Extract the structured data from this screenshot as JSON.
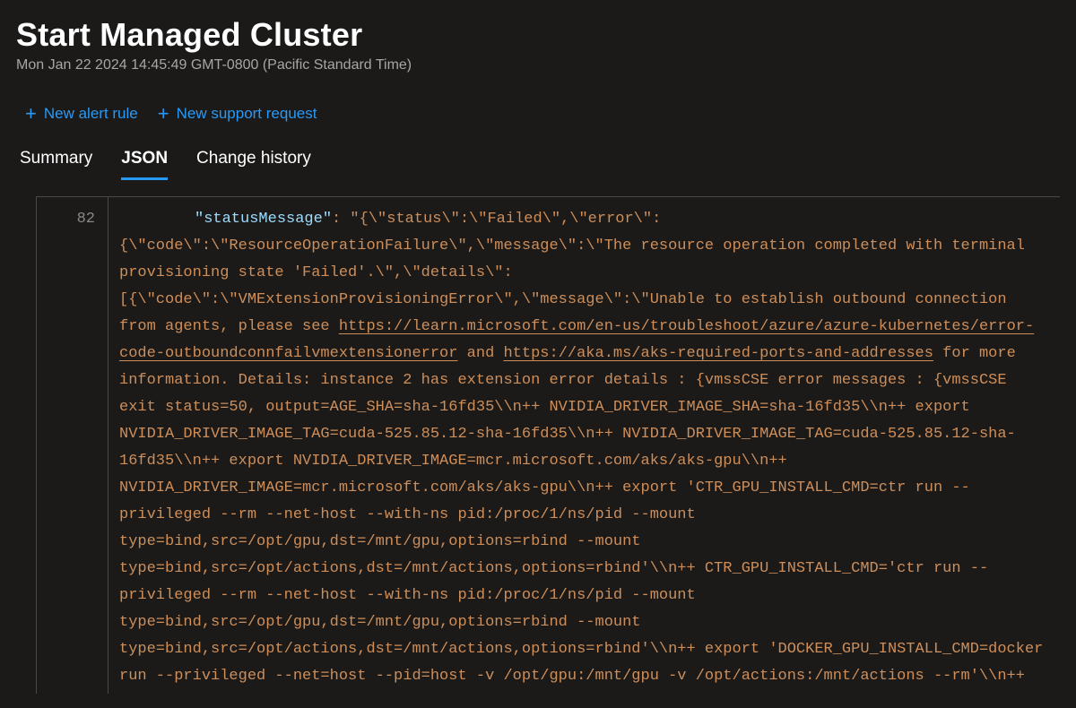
{
  "header": {
    "title": "Start Managed Cluster",
    "subtitle": "Mon Jan 22 2024 14:45:49 GMT-0800 (Pacific Standard Time)"
  },
  "actions": {
    "new_alert": "New alert rule",
    "new_support": "New support request"
  },
  "tabs": {
    "summary": "Summary",
    "json": "JSON",
    "change_history": "Change history"
  },
  "code": {
    "line_number": "82",
    "json_key": "\"statusMessage\"",
    "pre_link_a": ": \"{\\\"status\\\":\\\"Failed\\\",\\\"error\\\":{\\\"code\\\":\\\"ResourceOperationFailure\\\",\\\"message\\\":\\\"The resource operation completed with terminal provisioning state 'Failed'.\\\",\\\"details\\\":[{\\\"code\\\":\\\"VMExtensionProvisioningError\\\",\\\"message\\\":\\\"Unable to establish outbound connection from agents, please see ",
    "link_a": "https://learn.microsoft.com/en-us/troubleshoot/azure/azure-kubernetes/error-code-outboundconnfailvmextensionerror",
    "between_links": " and ",
    "link_b": "https://aka.ms/aks-required-ports-and-addresses",
    "post_link_b": " for more information. Details: instance 2 has extension error details : {vmssCSE error messages : {vmssCSE exit status=50, output=AGE_SHA=sha-16fd35\\\\n++ NVIDIA_DRIVER_IMAGE_SHA=sha-16fd35\\\\n++ export NVIDIA_DRIVER_IMAGE_TAG=cuda-525.85.12-sha-16fd35\\\\n++ NVIDIA_DRIVER_IMAGE_TAG=cuda-525.85.12-sha-16fd35\\\\n++ export NVIDIA_DRIVER_IMAGE=mcr.microsoft.com/aks/aks-gpu\\\\n++ NVIDIA_DRIVER_IMAGE=mcr.microsoft.com/aks/aks-gpu\\\\n++ export 'CTR_GPU_INSTALL_CMD=ctr run --privileged --rm --net-host --with-ns pid:/proc/1/ns/pid --mount type=bind,src=/opt/gpu,dst=/mnt/gpu,options=rbind --mount type=bind,src=/opt/actions,dst=/mnt/actions,options=rbind'\\\\n++ CTR_GPU_INSTALL_CMD='ctr run --privileged --rm --net-host --with-ns pid:/proc/1/ns/pid --mount type=bind,src=/opt/gpu,dst=/mnt/gpu,options=rbind --mount type=bind,src=/opt/actions,dst=/mnt/actions,options=rbind'\\\\n++ export 'DOCKER_GPU_INSTALL_CMD=docker run --privileged --net=host --pid=host -v /opt/gpu:/mnt/gpu -v /opt/actions:/mnt/actions --rm'\\\\n++ DOCKER_GPU_INSTALL_CMD='docker run --privileged"
  }
}
